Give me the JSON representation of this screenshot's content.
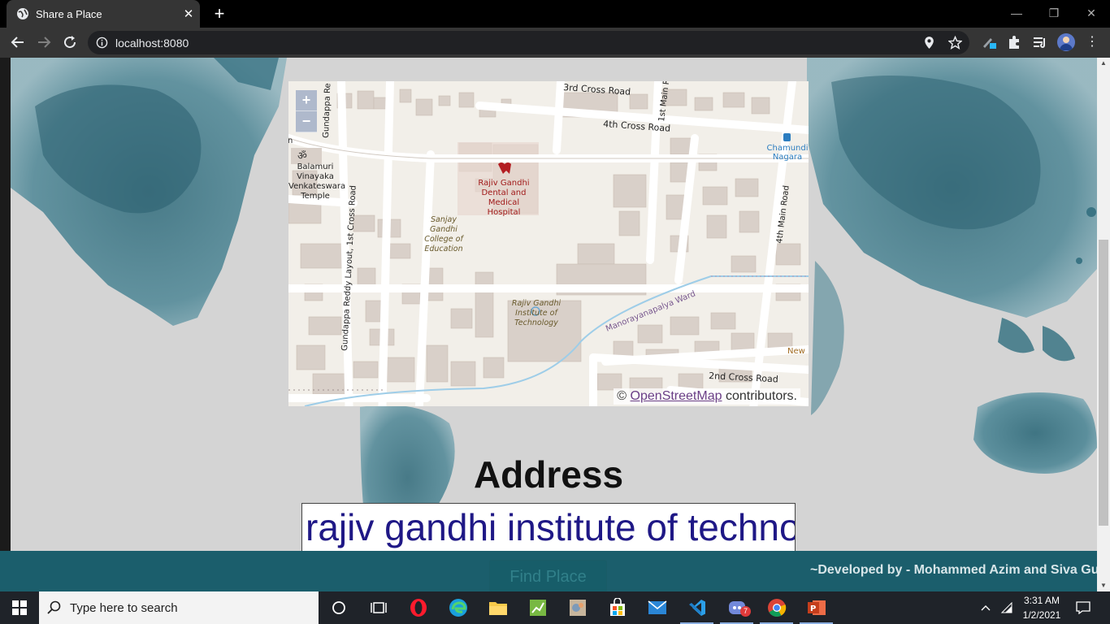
{
  "browser": {
    "tab_title": "Share a Place",
    "new_tab_symbol": "+",
    "tab_close_symbol": "✕",
    "url": "localhost:8080",
    "window_controls": {
      "minimize": "—",
      "restore": "❐",
      "close": "✕"
    }
  },
  "map": {
    "zoom_in": "+",
    "zoom_out": "−",
    "attribution_prefix": "©",
    "attribution_link": "OpenStreetMap",
    "attribution_suffix": "contributors.",
    "labels": {
      "road_3rd_cross": "3rd Cross Road",
      "road_4th_cross": "4th Cross Road",
      "road_1st_main": "1st Main R",
      "road_gundappa": "Gundappa Re",
      "road_4th_main": "4th Main Road",
      "road_2nd_cross": "2nd Cross Road",
      "road_gundappa_reddy": "Gundappa Reddy Layout, 1st Cross Road",
      "ward": "Manorayanapalya Ward",
      "temple": "Balamuri Vinayaka Venkateswara Temple",
      "hospital": "Rajiv Gandhi Dental and Medical Hospital",
      "college": "Sanjay Gandhi College of Education",
      "institute": "Rajiv Gandhi Institute of Technology",
      "chamundi": "Chamundi Nagara",
      "new": "New I",
      "edge_n": "n"
    }
  },
  "address": {
    "heading": "Address",
    "input_value": "rajiv gandhi institute of technology"
  },
  "footer": {
    "find_button": "Find Place",
    "developed_by": "~Developed by - Mohammed Azim and Siva Guru"
  },
  "taskbar": {
    "search_placeholder": "Type here to search",
    "time": "3:31 AM",
    "date": "1/2/2021",
    "discord_badge": "7"
  }
}
